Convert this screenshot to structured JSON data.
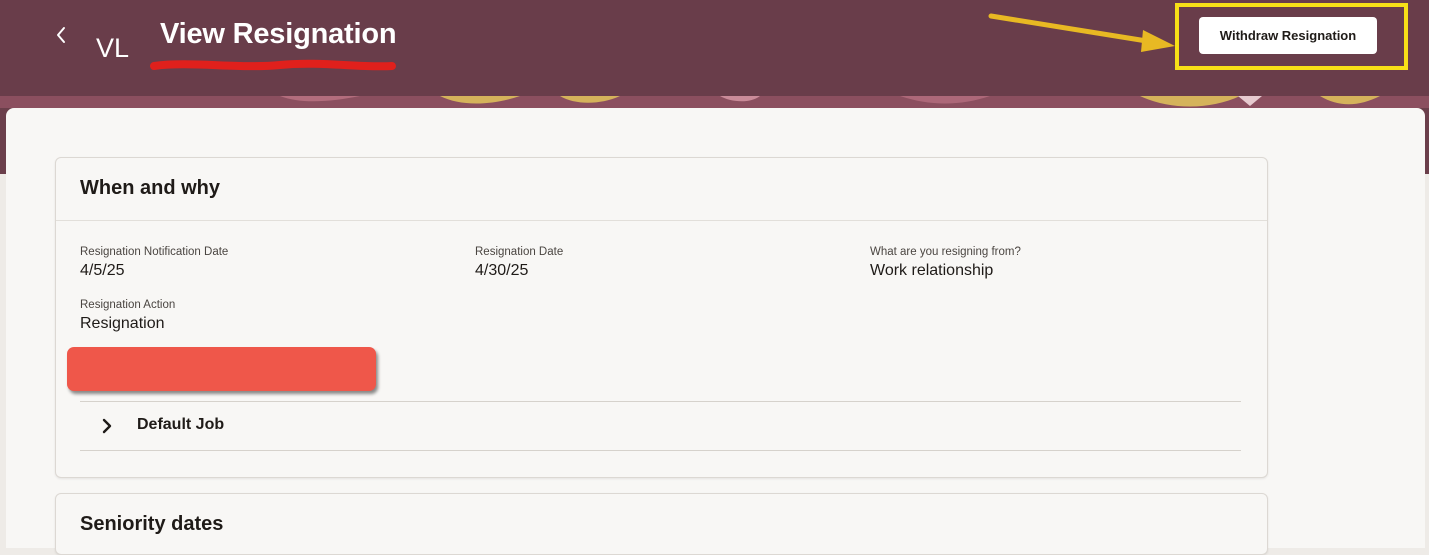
{
  "header": {
    "back_icon": "chevron-left-icon",
    "avatar_initials": "VL",
    "title": "View Resignation",
    "withdraw_label": "Withdraw Resignation",
    "background_color": "#693d4a",
    "highlight_color": "#f7e017",
    "annotation_arrow_color": "#e8b923"
  },
  "when_and_why": {
    "title": "When and why",
    "fields": {
      "notification_date_label": "Resignation Notification Date",
      "notification_date_value": "4/5/25",
      "resignation_date_label": "Resignation Date",
      "resignation_date_value": "4/30/25",
      "resigning_from_label": "What are you resigning from?",
      "resigning_from_value": "Work relationship",
      "action_label": "Resignation Action",
      "action_value": "Resignation"
    },
    "redaction_color": "#ef574a",
    "default_job_label": "Default Job",
    "default_job_icon": "chevron-right-icon"
  },
  "seniority": {
    "title": "Seniority dates"
  }
}
